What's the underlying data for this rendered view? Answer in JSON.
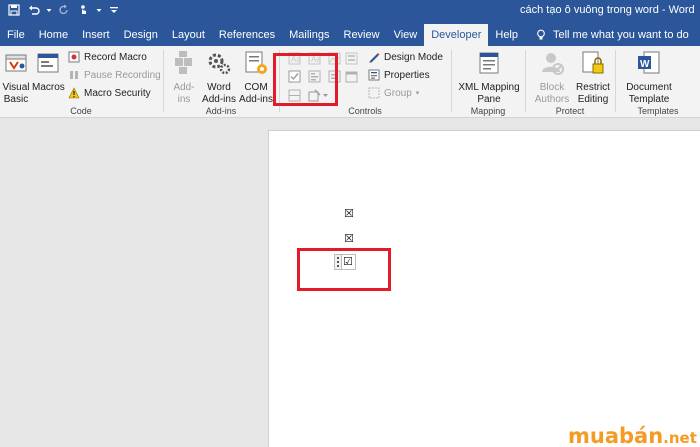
{
  "window": {
    "title": "cách tạo ô vuông trong word  -  Word"
  },
  "quick_access": [
    {
      "icon": "save-icon"
    },
    {
      "icon": "undo-icon"
    },
    {
      "icon": "redo-icon"
    },
    {
      "icon": "touch-mode-icon"
    },
    {
      "icon": "customize-qat-icon"
    }
  ],
  "tabs": [
    {
      "label": "File"
    },
    {
      "label": "Home"
    },
    {
      "label": "Insert"
    },
    {
      "label": "Design"
    },
    {
      "label": "Layout"
    },
    {
      "label": "References"
    },
    {
      "label": "Mailings"
    },
    {
      "label": "Review"
    },
    {
      "label": "View"
    },
    {
      "label": "Developer",
      "active": true
    },
    {
      "label": "Help"
    }
  ],
  "tell_me": "Tell me what you want to do",
  "ribbon": {
    "code": {
      "label": "Code",
      "visual_basic": "Visual\nBasic",
      "macros": "Macros",
      "record_macro": "Record Macro",
      "pause_recording": "Pause Recording",
      "macro_security": "Macro Security"
    },
    "addins": {
      "label": "Add-ins",
      "add_ins": "Add-\nins",
      "word_addins": "Word\nAdd-ins",
      "com_addins": "COM\nAdd-ins"
    },
    "controls": {
      "label": "Controls",
      "design_mode": "Design Mode",
      "properties": "Properties",
      "group": "Group"
    },
    "mapping": {
      "label": "Mapping",
      "xml_mapping": "XML Mapping\nPane"
    },
    "protect": {
      "label": "Protect",
      "block_authors": "Block\nAuthors",
      "restrict_editing": "Restrict\nEditing"
    },
    "templates": {
      "label": "Templates",
      "document_template": "Document\nTemplate"
    }
  },
  "document": {
    "checkbox_1": "☒",
    "checkbox_2": "☒",
    "checkbox_3": "☑"
  },
  "watermark": {
    "text": "muabán",
    "suffix": ".net"
  },
  "colors": {
    "title_bar": "#2b579a",
    "highlight": "#e21b2b",
    "watermark": "#f59a23"
  }
}
